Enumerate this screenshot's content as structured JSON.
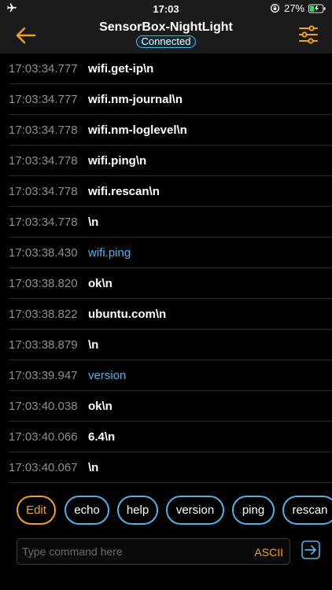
{
  "status_bar": {
    "time": "17:03",
    "battery": "27%",
    "icons": [
      "airplane-icon",
      "rotation-lock-icon",
      "battery-icon"
    ]
  },
  "header": {
    "title": "SensorBox-NightLight",
    "status": "Connected",
    "icons": [
      "back-arrow-icon",
      "sliders-icon"
    ]
  },
  "log": [
    {
      "time": "17:03:34.777",
      "msg": "wifi.get-ip\\n",
      "kind": "response"
    },
    {
      "time": "17:03:34.777",
      "msg": "wifi.nm-journal\\n",
      "kind": "response"
    },
    {
      "time": "17:03:34.778",
      "msg": "wifi.nm-loglevel\\n",
      "kind": "response"
    },
    {
      "time": "17:03:34.778",
      "msg": "wifi.ping\\n",
      "kind": "response"
    },
    {
      "time": "17:03:34.778",
      "msg": "wifi.rescan\\n",
      "kind": "response"
    },
    {
      "time": "17:03:34.778",
      "msg": "\\n",
      "kind": "response"
    },
    {
      "time": "17:03:38.430",
      "msg": "wifi.ping",
      "kind": "command"
    },
    {
      "time": "17:03:38.820",
      "msg": "ok\\n",
      "kind": "response"
    },
    {
      "time": "17:03:38.822",
      "msg": "ubuntu.com\\n",
      "kind": "response"
    },
    {
      "time": "17:03:38.879",
      "msg": "\\n",
      "kind": "response"
    },
    {
      "time": "17:03:39.947",
      "msg": "version",
      "kind": "command"
    },
    {
      "time": "17:03:40.038",
      "msg": "ok\\n",
      "kind": "response"
    },
    {
      "time": "17:03:40.066",
      "msg": "6.4\\n",
      "kind": "response"
    },
    {
      "time": "17:03:40.067",
      "msg": "\\n",
      "kind": "response"
    }
  ],
  "quick_buttons": {
    "edit": "Edit",
    "echo": "echo",
    "help": "help",
    "version": "version",
    "ping": "ping",
    "rescan": "rescan"
  },
  "command_input": {
    "placeholder": "Type command here",
    "value": "",
    "mode": "ASCII"
  },
  "colors": {
    "accent_orange": "#f5a021",
    "accent_blue": "#4fb3e8",
    "background": "#000000",
    "header_bg": "#1b1b1b",
    "timestamp": "#8e8e93"
  }
}
